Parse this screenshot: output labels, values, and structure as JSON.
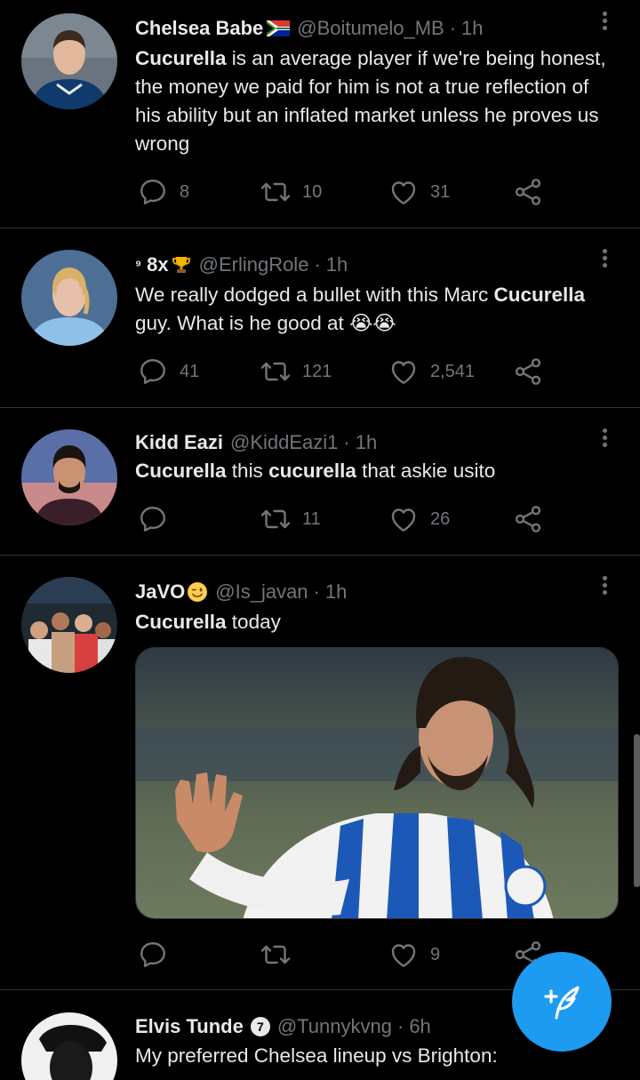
{
  "tweets": [
    {
      "name": "Chelsea Babe",
      "handle": "@Boitumelo_MB",
      "time": "1h",
      "body_html": "<b>Cucurella</b> is an average player if we're being honest, the money we paid for him is not a true reflection of his ability but an inflated market unless he proves us wrong",
      "replies": "8",
      "retweets": "10",
      "likes": "31"
    },
    {
      "prefix": "⁹",
      "name": "8x",
      "handle": "@ErlingRole",
      "time": "1h",
      "body_html": "We really dodged a bullet with this Marc <b>Cucurella</b> guy. What is he good at 😭😭",
      "replies": "41",
      "retweets": "121",
      "likes": "2,541"
    },
    {
      "name": "Kidd Eazi",
      "handle": "@KiddEazi1",
      "time": "1h",
      "body_html": "<b>Cucurella</b> this <b>cucurella</b> that askie usito",
      "replies": "",
      "retweets": "11",
      "likes": "26"
    },
    {
      "name": "JaVO",
      "handle": "@Is_javan",
      "time": "1h",
      "body_html": "<b>Cucurella</b> today",
      "replies": "",
      "retweets": "",
      "likes": "9"
    },
    {
      "name": "Elvis Tunde",
      "handle": "@Tunnykvng",
      "time": "6h",
      "badge": "7",
      "body_html": "My preferred Chelsea lineup vs Brighton:"
    }
  ],
  "separator": "·",
  "colors": {
    "background": "#000000",
    "text": "#e7e9ea",
    "secondary": "#71767b",
    "accent": "#1d9bf0",
    "divider": "#2f3336"
  },
  "icons": [
    "reply-icon",
    "retweet-icon",
    "like-icon",
    "share-icon",
    "more-icon",
    "compose-icon",
    "trophy-icon",
    "south-africa-flag-icon",
    "winking-face-icon"
  ]
}
